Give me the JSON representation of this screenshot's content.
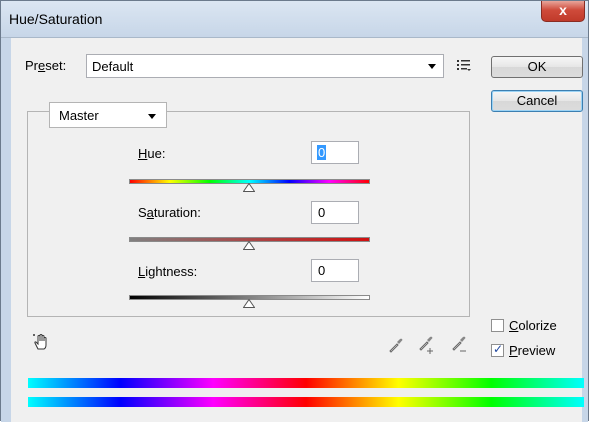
{
  "window": {
    "title": "Hue/Saturation",
    "close_glyph": "x"
  },
  "preset": {
    "label_pre": "Pr",
    "label_ul": "e",
    "label_post": "set:",
    "value": "Default",
    "menu_icon": "preset-options-icon"
  },
  "buttons": {
    "ok": "OK",
    "cancel_pre": "",
    "cancel_ul": "",
    "cancel": "Cancel"
  },
  "channel": {
    "value": "Master"
  },
  "hue": {
    "label_ul": "H",
    "label_rest": "ue:",
    "value": "0",
    "position": 0.5
  },
  "saturation": {
    "label_pre": "S",
    "label_ul": "a",
    "label_rest": "turation:",
    "value": "0",
    "position": 0.5
  },
  "lightness": {
    "label_ul": "L",
    "label_rest": "ightness:",
    "value": "0",
    "position": 0.5
  },
  "options": {
    "colorize": {
      "label_pre": "",
      "label_ul": "C",
      "label_rest": "olorize",
      "checked": false
    },
    "preview": {
      "label_pre": "",
      "label_ul": "P",
      "label_rest": "review",
      "checked": true,
      "mark": "✓"
    }
  },
  "icons": [
    "targeted-adjustment-hand-icon",
    "eyedropper-icon",
    "eyedropper-plus-icon",
    "eyedropper-minus-icon"
  ]
}
